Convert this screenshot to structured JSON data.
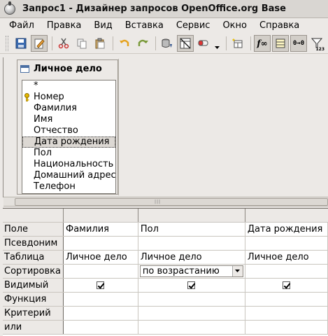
{
  "window": {
    "title": "Запрос1 - Дизайнер запросов OpenOffice.org Base"
  },
  "menubar": {
    "items": [
      {
        "label": "Файл"
      },
      {
        "label": "Правка"
      },
      {
        "label": "Вид"
      },
      {
        "label": "Вставка"
      },
      {
        "label": "Сервис"
      },
      {
        "label": "Окно"
      },
      {
        "label": "Справка"
      }
    ]
  },
  "toolbar": {
    "buttons": [
      {
        "icon": "save-icon"
      },
      {
        "icon": "edit-mode-icon",
        "pressed": true
      },
      {
        "icon": "cut-icon"
      },
      {
        "icon": "copy-icon"
      },
      {
        "icon": "paste-icon"
      },
      {
        "icon": "undo-icon"
      },
      {
        "icon": "redo-icon"
      },
      {
        "icon": "run-query-icon"
      },
      {
        "icon": "design-view-toggle-icon",
        "pressed": true
      },
      {
        "icon": "clear-query-icon"
      },
      {
        "icon": "add-table-icon"
      },
      {
        "icon": "functions-icon",
        "pressed": true
      },
      {
        "icon": "table-name-icon",
        "pressed": true
      },
      {
        "icon": "alias-icon"
      },
      {
        "icon": "distinct-values-icon"
      }
    ],
    "functions_label": "f∞",
    "alias_label": "0→0",
    "distinct_label": "123"
  },
  "table_window": {
    "title": "Личное дело",
    "fields": [
      {
        "label": "*",
        "key": false,
        "selected": false
      },
      {
        "label": "Номер",
        "key": true,
        "selected": false
      },
      {
        "label": "Фамилия",
        "key": false,
        "selected": false
      },
      {
        "label": "Имя",
        "key": false,
        "selected": false
      },
      {
        "label": "Отчество",
        "key": false,
        "selected": false
      },
      {
        "label": "Дата рождения",
        "key": false,
        "selected": true
      },
      {
        "label": "Пол",
        "key": false,
        "selected": false
      },
      {
        "label": "Национальность",
        "key": false,
        "selected": false
      },
      {
        "label": "Домашний адрес",
        "key": false,
        "selected": false
      },
      {
        "label": "Телефон",
        "key": false,
        "selected": false
      }
    ]
  },
  "design_grid": {
    "row_labels": {
      "field": "Поле",
      "alias": "Псевдоним",
      "table": "Таблица",
      "sort": "Сортировка",
      "visible": "Видимый",
      "function": "Функция",
      "criterion": "Критерий",
      "or": "или"
    },
    "columns": [
      {
        "field": "Фамилия",
        "alias": "",
        "table": "Личное дело",
        "sort": "",
        "visible": true
      },
      {
        "field": "Пол",
        "alias": "",
        "table": "Личное дело",
        "sort": "по возрастанию",
        "visible": true
      },
      {
        "field": "Дата рождения",
        "alias": "",
        "table": "Личное дело",
        "sort": "",
        "visible": true
      }
    ]
  }
}
